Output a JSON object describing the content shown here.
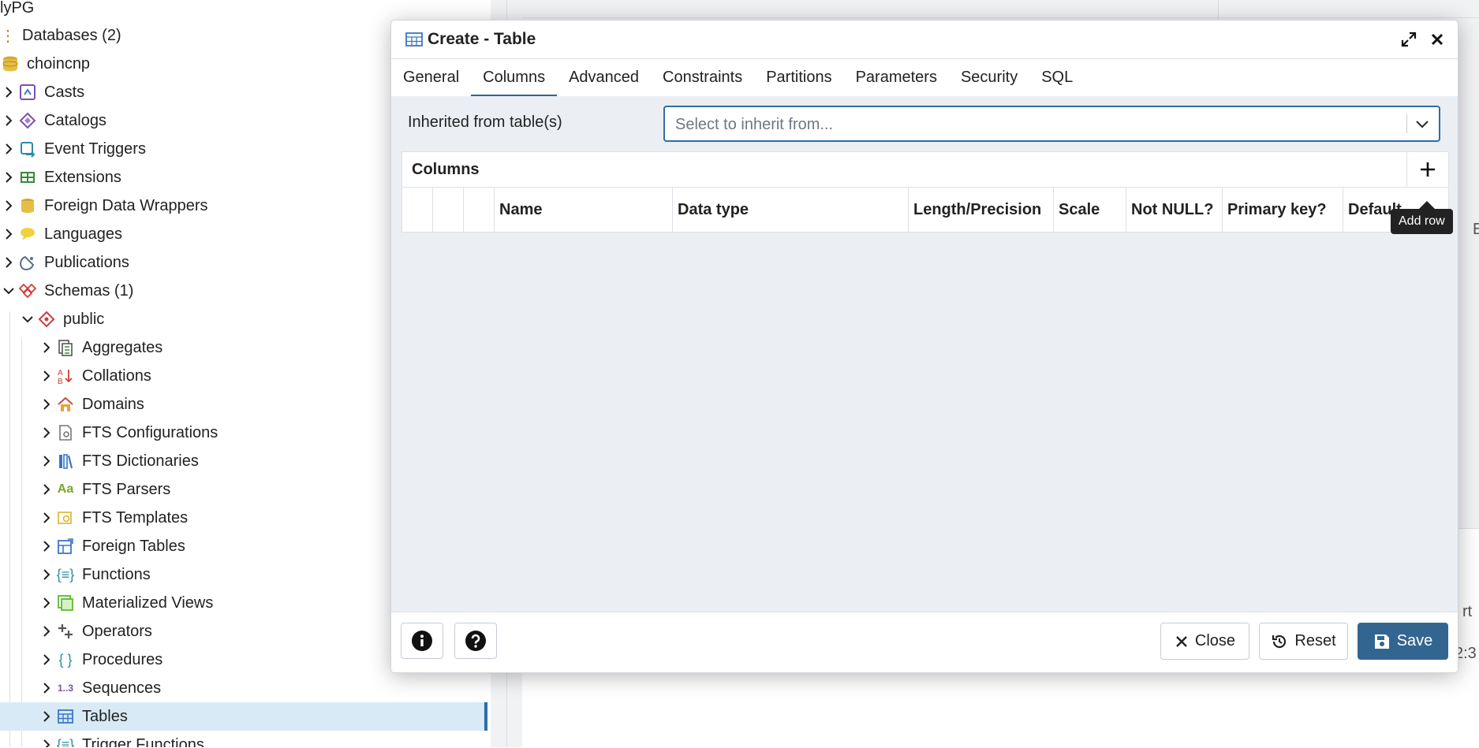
{
  "tree": {
    "server_label": "lyPG",
    "databases_label": "Databases (2)",
    "database_name": "choincnp",
    "items": [
      {
        "label": "Casts",
        "icon": "casts-icon"
      },
      {
        "label": "Catalogs",
        "icon": "catalogs-icon"
      },
      {
        "label": "Event Triggers",
        "icon": "event-triggers-icon"
      },
      {
        "label": "Extensions",
        "icon": "extensions-icon"
      },
      {
        "label": "Foreign Data Wrappers",
        "icon": "foreign-data-wrappers-icon"
      },
      {
        "label": "Languages",
        "icon": "languages-icon"
      },
      {
        "label": "Publications",
        "icon": "publications-icon"
      },
      {
        "label": "Schemas (1)",
        "icon": "schemas-icon"
      }
    ],
    "schema_name": "public",
    "schema_children": [
      {
        "label": "Aggregates",
        "icon": "aggregates-icon"
      },
      {
        "label": "Collations",
        "icon": "collations-icon"
      },
      {
        "label": "Domains",
        "icon": "domains-icon"
      },
      {
        "label": "FTS Configurations",
        "icon": "fts-configurations-icon"
      },
      {
        "label": "FTS Dictionaries",
        "icon": "fts-dictionaries-icon"
      },
      {
        "label": "FTS Parsers",
        "icon": "fts-parsers-icon",
        "glyph": "Aa"
      },
      {
        "label": "FTS Templates",
        "icon": "fts-templates-icon"
      },
      {
        "label": "Foreign Tables",
        "icon": "foreign-tables-icon"
      },
      {
        "label": "Functions",
        "icon": "functions-icon"
      },
      {
        "label": "Materialized Views",
        "icon": "materialized-views-icon"
      },
      {
        "label": "Operators",
        "icon": "operators-icon"
      },
      {
        "label": "Procedures",
        "icon": "procedures-icon"
      },
      {
        "label": "Sequences",
        "icon": "sequences-icon",
        "glyph": "1..3"
      },
      {
        "label": "Tables",
        "icon": "tables-icon"
      },
      {
        "label": "Trigger Functions",
        "icon": "trigger-functions-icon"
      }
    ]
  },
  "dialog": {
    "title": "Create - Table",
    "tabs": [
      "General",
      "Columns",
      "Advanced",
      "Constraints",
      "Partitions",
      "Parameters",
      "Security",
      "SQL"
    ],
    "active_tab": "Columns",
    "inherit_label": "Inherited from table(s)",
    "inherit_placeholder": "Select to inherit from...",
    "grid_title": "Columns",
    "columns": [
      "",
      "",
      "",
      "Name",
      "Data type",
      "Length/Precision",
      "Scale",
      "Not NULL?",
      "Primary key?",
      "Default"
    ],
    "tooltip": "Add row",
    "footer": {
      "close": "Close",
      "reset": "Reset",
      "save": "Save"
    }
  },
  "background_fragments": {
    "right_edge_1": "E",
    "right_edge_2": "rt",
    "right_edge_3": "2:3"
  },
  "colors": {
    "accent": "#326690",
    "selected_row": "#d7eaf6",
    "body_bg": "#ebeef3"
  }
}
